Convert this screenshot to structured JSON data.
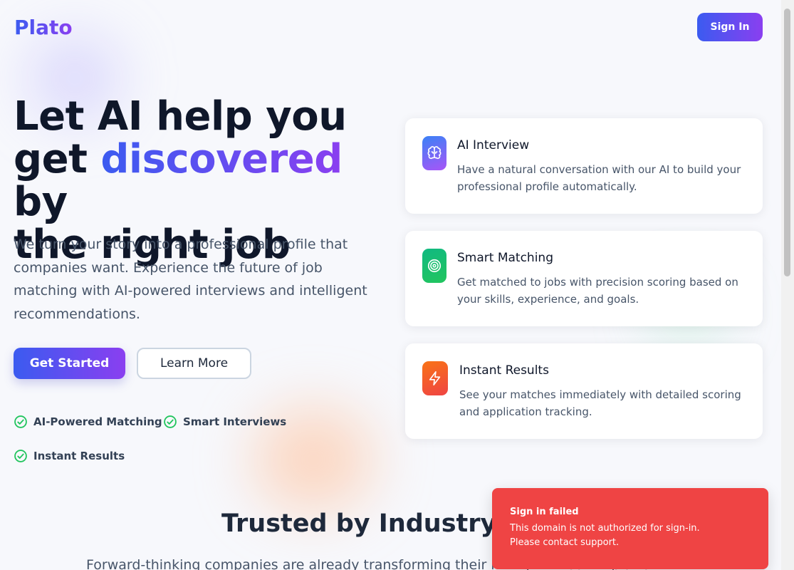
{
  "header": {
    "logo": "Plato",
    "sign_in_label": "Sign In"
  },
  "hero": {
    "title_line1": "Let AI help you",
    "title_get": "get ",
    "title_highlight": "discovered",
    "title_by": " by",
    "title_line3": "the right job",
    "subtitle": "We turn your story into a professional profile that companies want. Experience the future of job matching with AI-powered interviews and intelligent recommendations.",
    "primary_cta": "Get Started",
    "secondary_cta": "Learn More",
    "features": [
      "AI-Powered Matching",
      "Smart Interviews",
      "Instant Results"
    ]
  },
  "cards": [
    {
      "icon": "brain-icon",
      "title": "AI Interview",
      "description": "Have a natural conversation with our AI to build your professional profile automatically.",
      "gradient": [
        "#3b82f6",
        "#a855f7"
      ]
    },
    {
      "icon": "target-icon",
      "title": "Smart Matching",
      "description": "Get matched to jobs with precision scoring based on your skills, experience, and goals.",
      "gradient": [
        "#10b981",
        "#22c55e"
      ]
    },
    {
      "icon": "lightning-icon",
      "title": "Instant Results",
      "description": "See your matches immediately with detailed scoring and application tracking.",
      "gradient": [
        "#f97316",
        "#ef4444"
      ]
    }
  ],
  "trusted": {
    "title": "Trusted by Industry Leaders",
    "subtitle": "Forward-thinking companies are already transforming their hiring with our AI platform"
  },
  "toast": {
    "title": "Sign in failed",
    "message": "This domain is not authorized for sign-in. Please contact support.",
    "color": "#ef4444"
  },
  "colors": {
    "brand_start": "#3b5bf0",
    "brand_end": "#8a3ff0",
    "check_green": "#22c55e"
  }
}
